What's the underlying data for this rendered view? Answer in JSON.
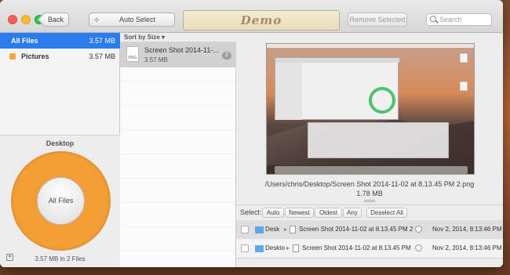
{
  "toolbar": {
    "back_label": "Back",
    "auto_select_label": "Auto Select",
    "logo_text": "Demo",
    "remove_selected_label": "Remove Selected",
    "search_placeholder": "Search"
  },
  "sidebar": {
    "items": [
      {
        "label": "All Files",
        "size": "3.57 MB",
        "selected": true
      },
      {
        "label": "Pictures",
        "size": "3.57 MB",
        "selected": false
      }
    ],
    "disk_title": "Desktop",
    "ring_label": "All Files",
    "status": "3.57 MB in 2 Files",
    "ring_color": "#f39e35",
    "accent_color": "#2b7bef"
  },
  "list": {
    "sort_label": "Sort by Size",
    "files": [
      {
        "name": "Screen Shot 2014-11-...",
        "size": "3.57 MB",
        "count": "2",
        "icon_label": "PNG"
      }
    ]
  },
  "preview": {
    "path": "/Users/chris/Desktop/Screen Shot 2014-11-02 at 8.13.45 PM 2.png",
    "size": "1.78 MB"
  },
  "select_bar": {
    "label": "Select:",
    "buttons": [
      "Auto",
      "Newest",
      "Oldest",
      "Any"
    ],
    "deselect_label": "Deselect All"
  },
  "duplicates": [
    {
      "folder": "Desk",
      "file": "Screen Shot 2014-11-02 at 8.13.45 PM 2",
      "date": "Nov 2, 2014, 8:13:46 PM"
    },
    {
      "folder": "Deskto",
      "file": "Screen Shot 2014-11-02 at 8.13.45 PM",
      "date": "Nov 2, 2014, 8:13:46 PM"
    }
  ]
}
